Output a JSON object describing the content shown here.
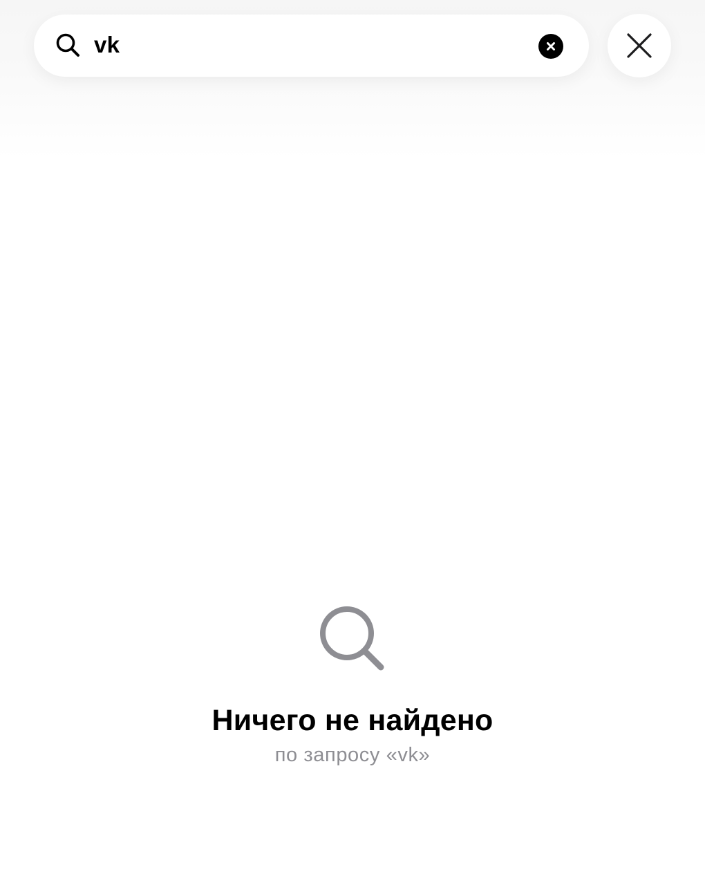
{
  "search": {
    "value": "vk",
    "icon": "search-icon",
    "clear_icon": "clear-icon",
    "close_icon": "close-icon"
  },
  "empty_state": {
    "icon": "search-icon",
    "title": "Ничего не найдено",
    "subtitle": "по запросу «vk»"
  },
  "colors": {
    "text": "#000000",
    "secondary_text": "#8e8e93",
    "icon_gray": "#8e8e93",
    "background": "#ffffff"
  }
}
